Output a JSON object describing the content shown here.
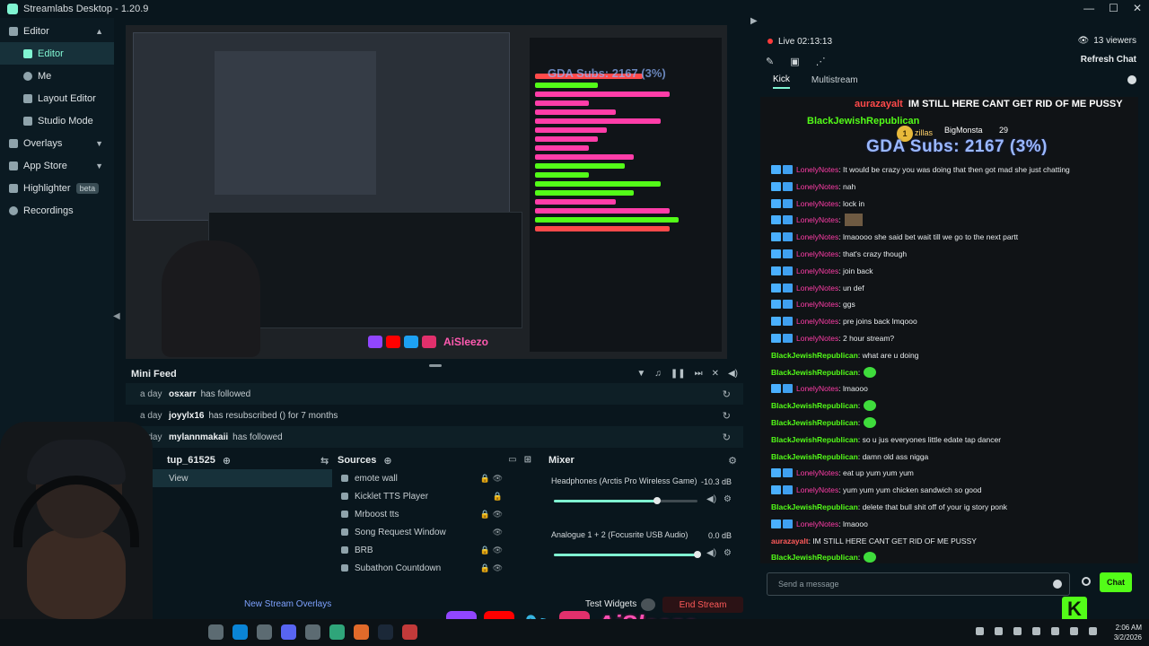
{
  "window": {
    "title": "Streamlabs Desktop - 1.20.9",
    "controls": [
      "—",
      "☐",
      "✕"
    ]
  },
  "sidebar": {
    "items": [
      {
        "label": "Editor",
        "icon": "editor-icon"
      },
      {
        "label": "Editor",
        "icon": "editor-icon"
      },
      {
        "label": "Me",
        "icon": "heart-icon"
      },
      {
        "label": "Layout Editor",
        "icon": "layout-icon"
      },
      {
        "label": "Studio Mode",
        "icon": "studio-mode-icon"
      },
      {
        "label": "Overlays",
        "icon": "overlays-icon"
      },
      {
        "label": "App Store",
        "icon": "store-icon"
      },
      {
        "label": "Highlighter",
        "icon": "highlighter-icon",
        "badge": "beta"
      },
      {
        "label": "Recordings",
        "icon": "recordings-icon"
      }
    ]
  },
  "preview": {
    "goal_text": "GDA Subs: 2167 (3%)",
    "handle": "AiSleezo"
  },
  "minifeed": {
    "title": "Mini Feed",
    "events": [
      {
        "when": "a day",
        "user": "osxarr",
        "action": "has followed"
      },
      {
        "when": "a day",
        "user": "joyylx16",
        "action": "has resubscribed () for 7 months"
      },
      {
        "when": "a day",
        "user": "mylannmakaii",
        "action": "has followed"
      }
    ]
  },
  "scenes": {
    "title": "tup_61525",
    "items": [
      {
        "label": "View"
      }
    ]
  },
  "sources": {
    "title": "Sources",
    "items": [
      {
        "label": "emote wall"
      },
      {
        "label": "Kicklet TTS Player"
      },
      {
        "label": "Mrboost tts"
      },
      {
        "label": "Song Request Window"
      },
      {
        "label": "BRB"
      },
      {
        "label": "Subathon Countdown"
      }
    ]
  },
  "mixer": {
    "title": "Mixer",
    "channels": [
      {
        "name": "Headphones (Arctis Pro Wireless Game)",
        "db": "-10.3 dB",
        "level": 0.72
      },
      {
        "name": "Analogue 1 + 2 (Focusrite USB Audio)",
        "db": "0.0 dB",
        "level": 1.0
      }
    ]
  },
  "footer": {
    "overlays_link": "New Stream Overlays",
    "test_widgets": "Test Widgets",
    "end_stream": "End Stream"
  },
  "chat": {
    "live": "Live 02:13:13",
    "viewers": "13 viewers",
    "refresh": "Refresh Chat",
    "tabs": [
      "Kick",
      "Multistream"
    ],
    "overlay": {
      "top_user": "aurazayalt",
      "top_msg": "IM STILL HERE CANT GET RID OF ME PUSSY",
      "user2": "BlackJewishRepublican",
      "follower": "BigMonsta",
      "follower_count": "29",
      "zillas": "zillas",
      "zillas_count": "1",
      "goal": "GDA Subs: 2167 (3%)"
    },
    "messages": [
      {
        "user": "LonelyNotes",
        "type": "ln",
        "text": ": It would be crazy you was doing that then got mad she just chatting"
      },
      {
        "user": "LonelyNotes",
        "type": "ln",
        "text": ": nah"
      },
      {
        "user": "LonelyNotes",
        "type": "ln",
        "text": ": lock in"
      },
      {
        "user": "LonelyNotes",
        "type": "ln",
        "text": ":",
        "emote": "img"
      },
      {
        "user": "LonelyNotes",
        "type": "ln",
        "text": ": lmaoooo she said bet wait till we go to the next partt"
      },
      {
        "user": "LonelyNotes",
        "type": "ln",
        "text": ": that's crazy though"
      },
      {
        "user": "LonelyNotes",
        "type": "ln",
        "text": ": join back"
      },
      {
        "user": "LonelyNotes",
        "type": "ln",
        "text": ": un def"
      },
      {
        "user": "LonelyNotes",
        "type": "ln",
        "text": ": ggs"
      },
      {
        "user": "LonelyNotes",
        "type": "ln",
        "text": ": pre joins back lmqooo"
      },
      {
        "user": "LonelyNotes",
        "type": "ln",
        "text": ": 2 hour stream?"
      },
      {
        "user": "BlackJewishRepublican",
        "type": "bjr",
        "text": ": what are u doing"
      },
      {
        "user": "BlackJewishRepublican",
        "type": "bjr",
        "text": ":",
        "emote": "green"
      },
      {
        "user": "LonelyNotes",
        "type": "ln",
        "text": ": lmaooo"
      },
      {
        "user": "BlackJewishRepublican",
        "type": "bjr",
        "text": ":",
        "emote": "green"
      },
      {
        "user": "BlackJewishRepublican",
        "type": "bjr",
        "text": ":",
        "emote": "green"
      },
      {
        "user": "BlackJewishRepublican",
        "type": "bjr",
        "text": ": so u jus everyones little edate tap dancer"
      },
      {
        "user": "BlackJewishRepublican",
        "type": "bjr",
        "text": ": damn old ass nigga"
      },
      {
        "user": "LonelyNotes",
        "type": "ln",
        "text": ": eat up yum yum yum"
      },
      {
        "user": "LonelyNotes",
        "type": "ln",
        "text": ": yum yum yum chicken sandwich so good"
      },
      {
        "user": "BlackJewishRepublican",
        "type": "bjr",
        "text": ": delete that bull shit off of your ig story ponk"
      },
      {
        "user": "LonelyNotes",
        "type": "ln",
        "text": ": lmaooo"
      },
      {
        "user": "aurazayalt",
        "type": "au",
        "text": ": IM STILL HERE CANT GET RID OF ME PUSSY"
      },
      {
        "user": "BlackJewishRepublican",
        "type": "bjr",
        "text": ":",
        "emote": "green"
      }
    ],
    "input_placeholder": "Send a message",
    "send_label": "Chat"
  },
  "socials": {
    "handle": "AiSleezo"
  },
  "taskbar": {
    "time": "2:06 AM",
    "date": "3/2/2026"
  },
  "colors": {
    "accent": "#80f5d2",
    "kick_green": "#53fc18",
    "live_red": "#ff3b3b",
    "lonely_pink": "#ff3da8"
  }
}
